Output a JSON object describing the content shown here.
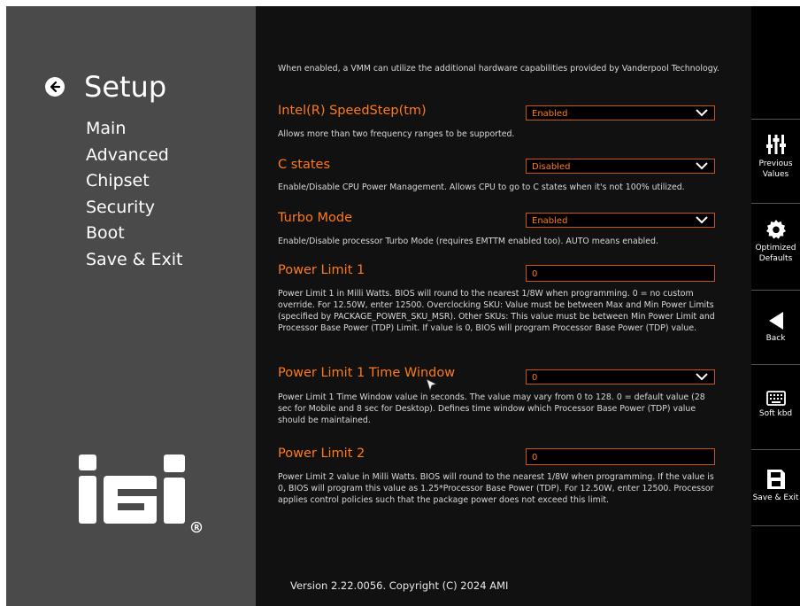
{
  "nav": {
    "title": "Setup",
    "items": [
      {
        "label": "Main"
      },
      {
        "label": "Advanced"
      },
      {
        "label": "Chipset"
      },
      {
        "label": "Security"
      },
      {
        "label": "Boot"
      },
      {
        "label": "Save & Exit"
      }
    ]
  },
  "logo": {
    "text": "iEi",
    "mark": "®"
  },
  "main": {
    "intro_desc": "When enabled, a VMM can utilize the additional hardware capabilities provided by Vanderpool Technology.",
    "settings": [
      {
        "title": "Intel(R) SpeedStep(tm)",
        "value": "Enabled",
        "desc": "Allows more than two frequency ranges to be supported."
      },
      {
        "title": "C states",
        "value": "Disabled",
        "desc": "Enable/Disable CPU Power Management. Allows CPU to go to C states when it's not 100% utilized."
      },
      {
        "title": "Turbo Mode",
        "value": "Enabled",
        "desc": "Enable/Disable processor Turbo Mode (requires EMTTM enabled too). AUTO means enabled."
      },
      {
        "title": "Power Limit 1",
        "value": "0",
        "desc": "Power Limit 1 in Milli Watts. BIOS will round to the nearest 1/8W when programming. 0 = no custom override. For 12.50W, enter 12500. Overclocking SKU: Value must be between Max and Min Power Limits (specified by PACKAGE_POWER_SKU_MSR). Other SKUs: This value must be between Min Power Limit and Processor Base Power (TDP) Limit. If value is 0, BIOS will program Processor Base Power (TDP) value."
      },
      {
        "title": "Power Limit 1 Time Window",
        "value": "0",
        "desc": "Power Limit 1 Time Window value in seconds. The value may vary from 0 to 128. 0 = default value (28 sec for Mobile and 8 sec for Desktop). Defines time window which Processor Base Power (TDP) value should be maintained."
      },
      {
        "title": "Power Limit 2",
        "value": "0",
        "desc": "Power Limit 2 value in Milli Watts. BIOS will round to the nearest 1/8W when programming. If the value is 0, BIOS will program this value as 1.25*Processor Base Power (TDP). For 12.50W, enter 12500. Processor applies control policies such that the package power does not exceed this limit."
      }
    ],
    "version": "Version 2.22.0056. Copyright (C) 2024 AMI"
  },
  "rightbar": {
    "buttons": [
      {
        "label1": "Previous",
        "label2": "Values",
        "icon": "sliders-icon"
      },
      {
        "label1": "Optimized",
        "label2": "Defaults",
        "icon": "gear-icon"
      },
      {
        "label1": "Back",
        "label2": "",
        "icon": "back-triangle-icon"
      },
      {
        "label1": "Soft kbd",
        "label2": "",
        "icon": "keyboard-icon"
      },
      {
        "label1": "Save & Exit",
        "label2": "",
        "icon": "save-icon"
      }
    ]
  },
  "colors": {
    "accent": "#ff7a1a",
    "nav_bg": "#4a4a4a",
    "main_bg": "#111111",
    "rightbar_bg": "#000000"
  }
}
